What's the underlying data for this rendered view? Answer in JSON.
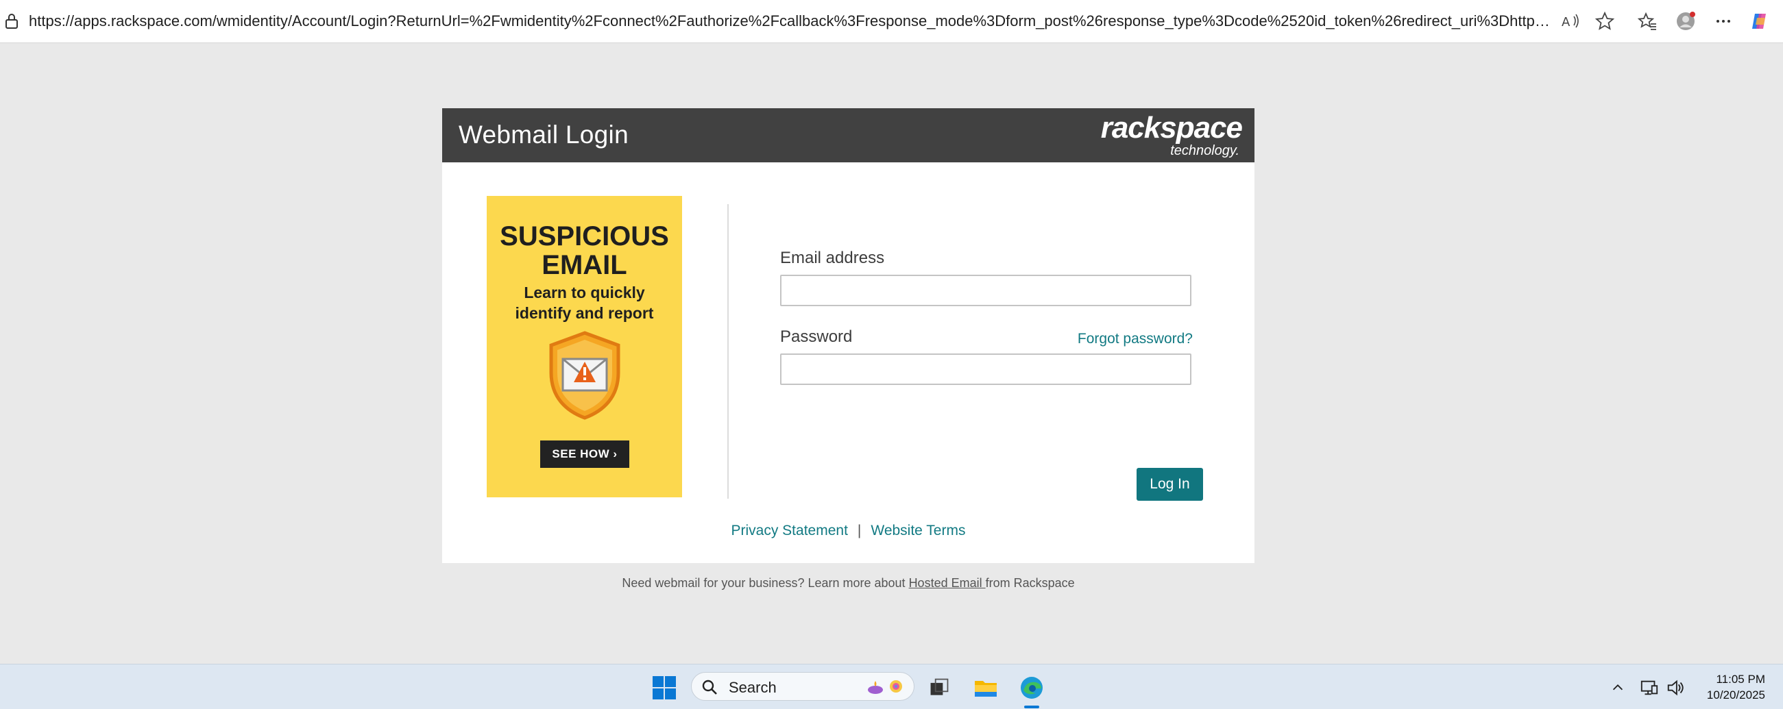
{
  "browser": {
    "url": "https://apps.rackspace.com/wmidentity/Account/Login?ReturnUrl=%2Fwmidentity%2Fconnect%2Fauthorize%2Fcallback%3Fresponse_mode%3Dform_post%26response_type%3Dcode%2520id_token%26redirect_uri%3Dhttps%253A%252F..."
  },
  "header": {
    "title": "Webmail Login",
    "brand_name": "rackspace",
    "brand_sub": "technology."
  },
  "promo": {
    "title_line1": "SUSPICIOUS",
    "title_line2": "EMAIL",
    "sub_line1": "Learn to quickly",
    "sub_line2": "identify and report",
    "button": "SEE HOW ›"
  },
  "form": {
    "email_label": "Email address",
    "email_value": "",
    "password_label": "Password",
    "password_value": "",
    "forgot_link": "Forgot password?",
    "login_button": "Log In"
  },
  "footer": {
    "privacy": "Privacy Statement",
    "separator": "|",
    "terms": "Website Terms"
  },
  "note": {
    "prefix": "Need webmail for your business? Learn more about ",
    "link": "Hosted Email ",
    "suffix": "from Rackspace"
  },
  "taskbar": {
    "search_label": "Search",
    "time": "11:05 PM",
    "date": "10/20/2025"
  },
  "colors": {
    "header_bg": "#414141",
    "accent_teal": "#11767f",
    "promo_yellow": "#fcd84e",
    "page_bg": "#e9e9e9"
  }
}
